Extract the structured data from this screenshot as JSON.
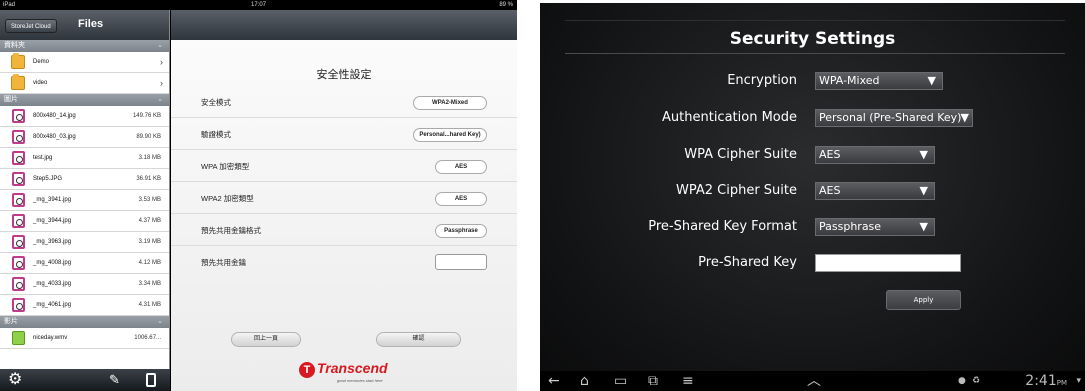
{
  "ipad": {
    "status": {
      "carrier": "iPad",
      "time": "17:07",
      "battery": "89 %"
    },
    "sidebar": {
      "cloud_button": "StoreJet Cloud",
      "title": "Files",
      "sections": [
        {
          "label": "資料夾"
        },
        {
          "label": "圖片"
        },
        {
          "label": "影片"
        }
      ],
      "folders": [
        {
          "name": "Demo"
        },
        {
          "name": "video"
        }
      ],
      "pictures": [
        {
          "name": "800x480_14.jpg",
          "size": "149.76 KB"
        },
        {
          "name": "800x480_03.jpg",
          "size": "89.90 KB"
        },
        {
          "name": "test.jpg",
          "size": "3.18 MB"
        },
        {
          "name": "Step5.JPG",
          "size": "36.91 KB"
        },
        {
          "name": "_mg_3941.jpg",
          "size": "3.53 MB"
        },
        {
          "name": "_mg_3944.jpg",
          "size": "4.37 MB"
        },
        {
          "name": "_mg_3963.jpg",
          "size": "3.19 MB"
        },
        {
          "name": "_mg_4008.jpg",
          "size": "4.12 MB"
        },
        {
          "name": "_mg_4033.jpg",
          "size": "3.34 MB"
        },
        {
          "name": "_mg_4061.jpg",
          "size": "4.31 MB"
        }
      ],
      "videos": [
        {
          "name": "niceday.wmv",
          "size": "1006.67..."
        }
      ]
    },
    "panel": {
      "title": "安全性設定",
      "rows": [
        {
          "label": "安全模式",
          "value": "WPA2-Mixed"
        },
        {
          "label": "驗證模式",
          "value": "Personal...hared Key)"
        },
        {
          "label": "WPA 加密類型",
          "value": "AES"
        },
        {
          "label": "WPA2 加密類型",
          "value": "AES"
        },
        {
          "label": "預先共用金鑰格式",
          "value": "Passphrase"
        },
        {
          "label": "預先共用金鑰",
          "value": ""
        }
      ],
      "back_button": "回上一頁",
      "confirm_button": "確認",
      "brand_name": "Transcend",
      "brand_tagline": "good memories start here"
    }
  },
  "android": {
    "title": "Security Settings",
    "fields": [
      {
        "label": "Encryption",
        "value": "WPA-Mixed"
      },
      {
        "label": "Authentication Mode",
        "value": "Personal (Pre-Shared Key)"
      },
      {
        "label": "WPA Cipher Suite",
        "value": "AES"
      },
      {
        "label": "WPA2 Cipher Suite",
        "value": "AES"
      },
      {
        "label": "Pre-Shared Key Format",
        "value": "Passphrase"
      },
      {
        "label": "Pre-Shared Key",
        "value": ""
      }
    ],
    "apply_label": "Apply",
    "clock": {
      "time": "2:41",
      "ampm": "PM"
    }
  }
}
